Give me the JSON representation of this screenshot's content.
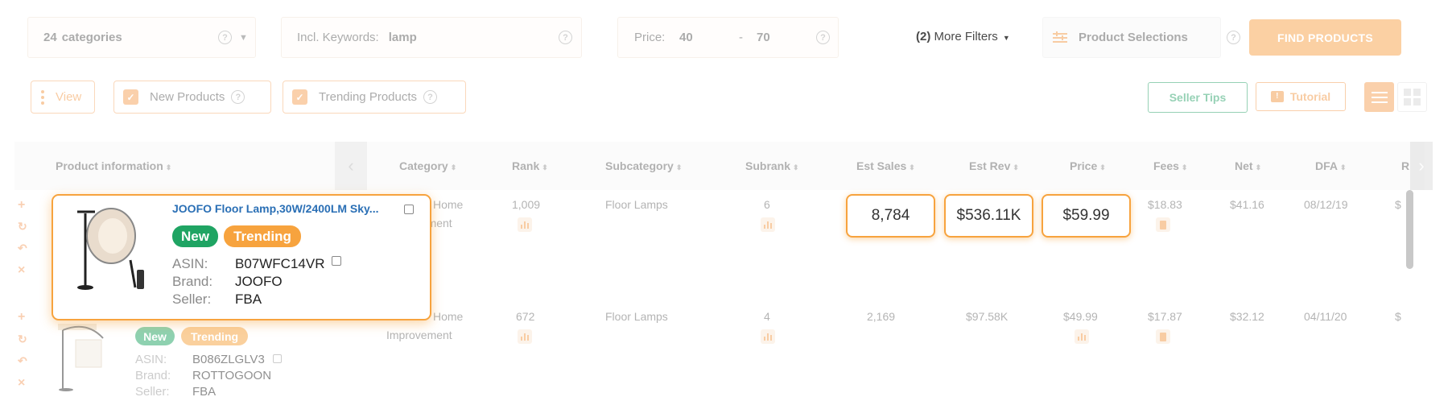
{
  "filters": {
    "categories_count": "24",
    "categories_label": "categories",
    "keywords_label": "Incl. Keywords:",
    "keywords_value": "lamp",
    "price_label": "Price:",
    "price_min": "40",
    "price_sep": "-",
    "price_max": "70",
    "more_filters_count": "(2)",
    "more_filters_label": "More Filters",
    "product_selections": "Product Selections",
    "find_products": "FIND PRODUCTS"
  },
  "options": {
    "view": "View",
    "new_products": "New Products",
    "trending_products": "Trending Products",
    "seller_tips": "Seller Tips",
    "tutorial": "Tutorial"
  },
  "columns": {
    "product_info": "Product information",
    "category": "Category",
    "rank": "Rank",
    "subcategory": "Subcategory",
    "subrank": "Subrank",
    "est_sales": "Est Sales",
    "est_rev": "Est Rev",
    "price": "Price",
    "fees": "Fees",
    "net": "Net",
    "dfa": "DFA",
    "cut_next": "R"
  },
  "rows": [
    {
      "title": "JOOFO Floor Lamp,30W/2400LM Sky...",
      "badge_new": "New",
      "badge_trending": "Trending",
      "asin_label": "ASIN:",
      "asin": "B07WFC14VR",
      "brand_label": "Brand:",
      "brand": "JOOFO",
      "seller_label": "Seller:",
      "seller": "FBA",
      "category_part1": "Home",
      "category_part2": "Improvement",
      "rank": "1,009",
      "subcategory": "Floor Lamps",
      "subrank": "6",
      "est_sales": "8,784",
      "est_rev": "$536.11K",
      "price": "$59.99",
      "fees": "$18.83",
      "net": "$41.16",
      "dfa": "08/12/19",
      "cut_next": "$"
    },
    {
      "badge_new": "New",
      "badge_trending": "Trending",
      "asin_label": "ASIN:",
      "asin": "B086ZLGLV3",
      "brand_label": "Brand:",
      "brand": "ROTTOGOON",
      "seller_label": "Seller:",
      "seller": "FBA",
      "category_part1": "Home",
      "category_part2": "Improvement",
      "rank": "672",
      "subcategory": "Floor Lamps",
      "subrank": "4",
      "est_sales": "2,169",
      "est_rev": "$97.58K",
      "price": "$49.99",
      "fees": "$17.87",
      "net": "$32.12",
      "dfa": "04/11/20",
      "cut_next": "$"
    }
  ],
  "colors": {
    "accent_orange": "#f9a24a",
    "new_green": "#1fa463",
    "trending_orange": "#f7a33e",
    "seller_tips_green": "#2fa56e"
  }
}
